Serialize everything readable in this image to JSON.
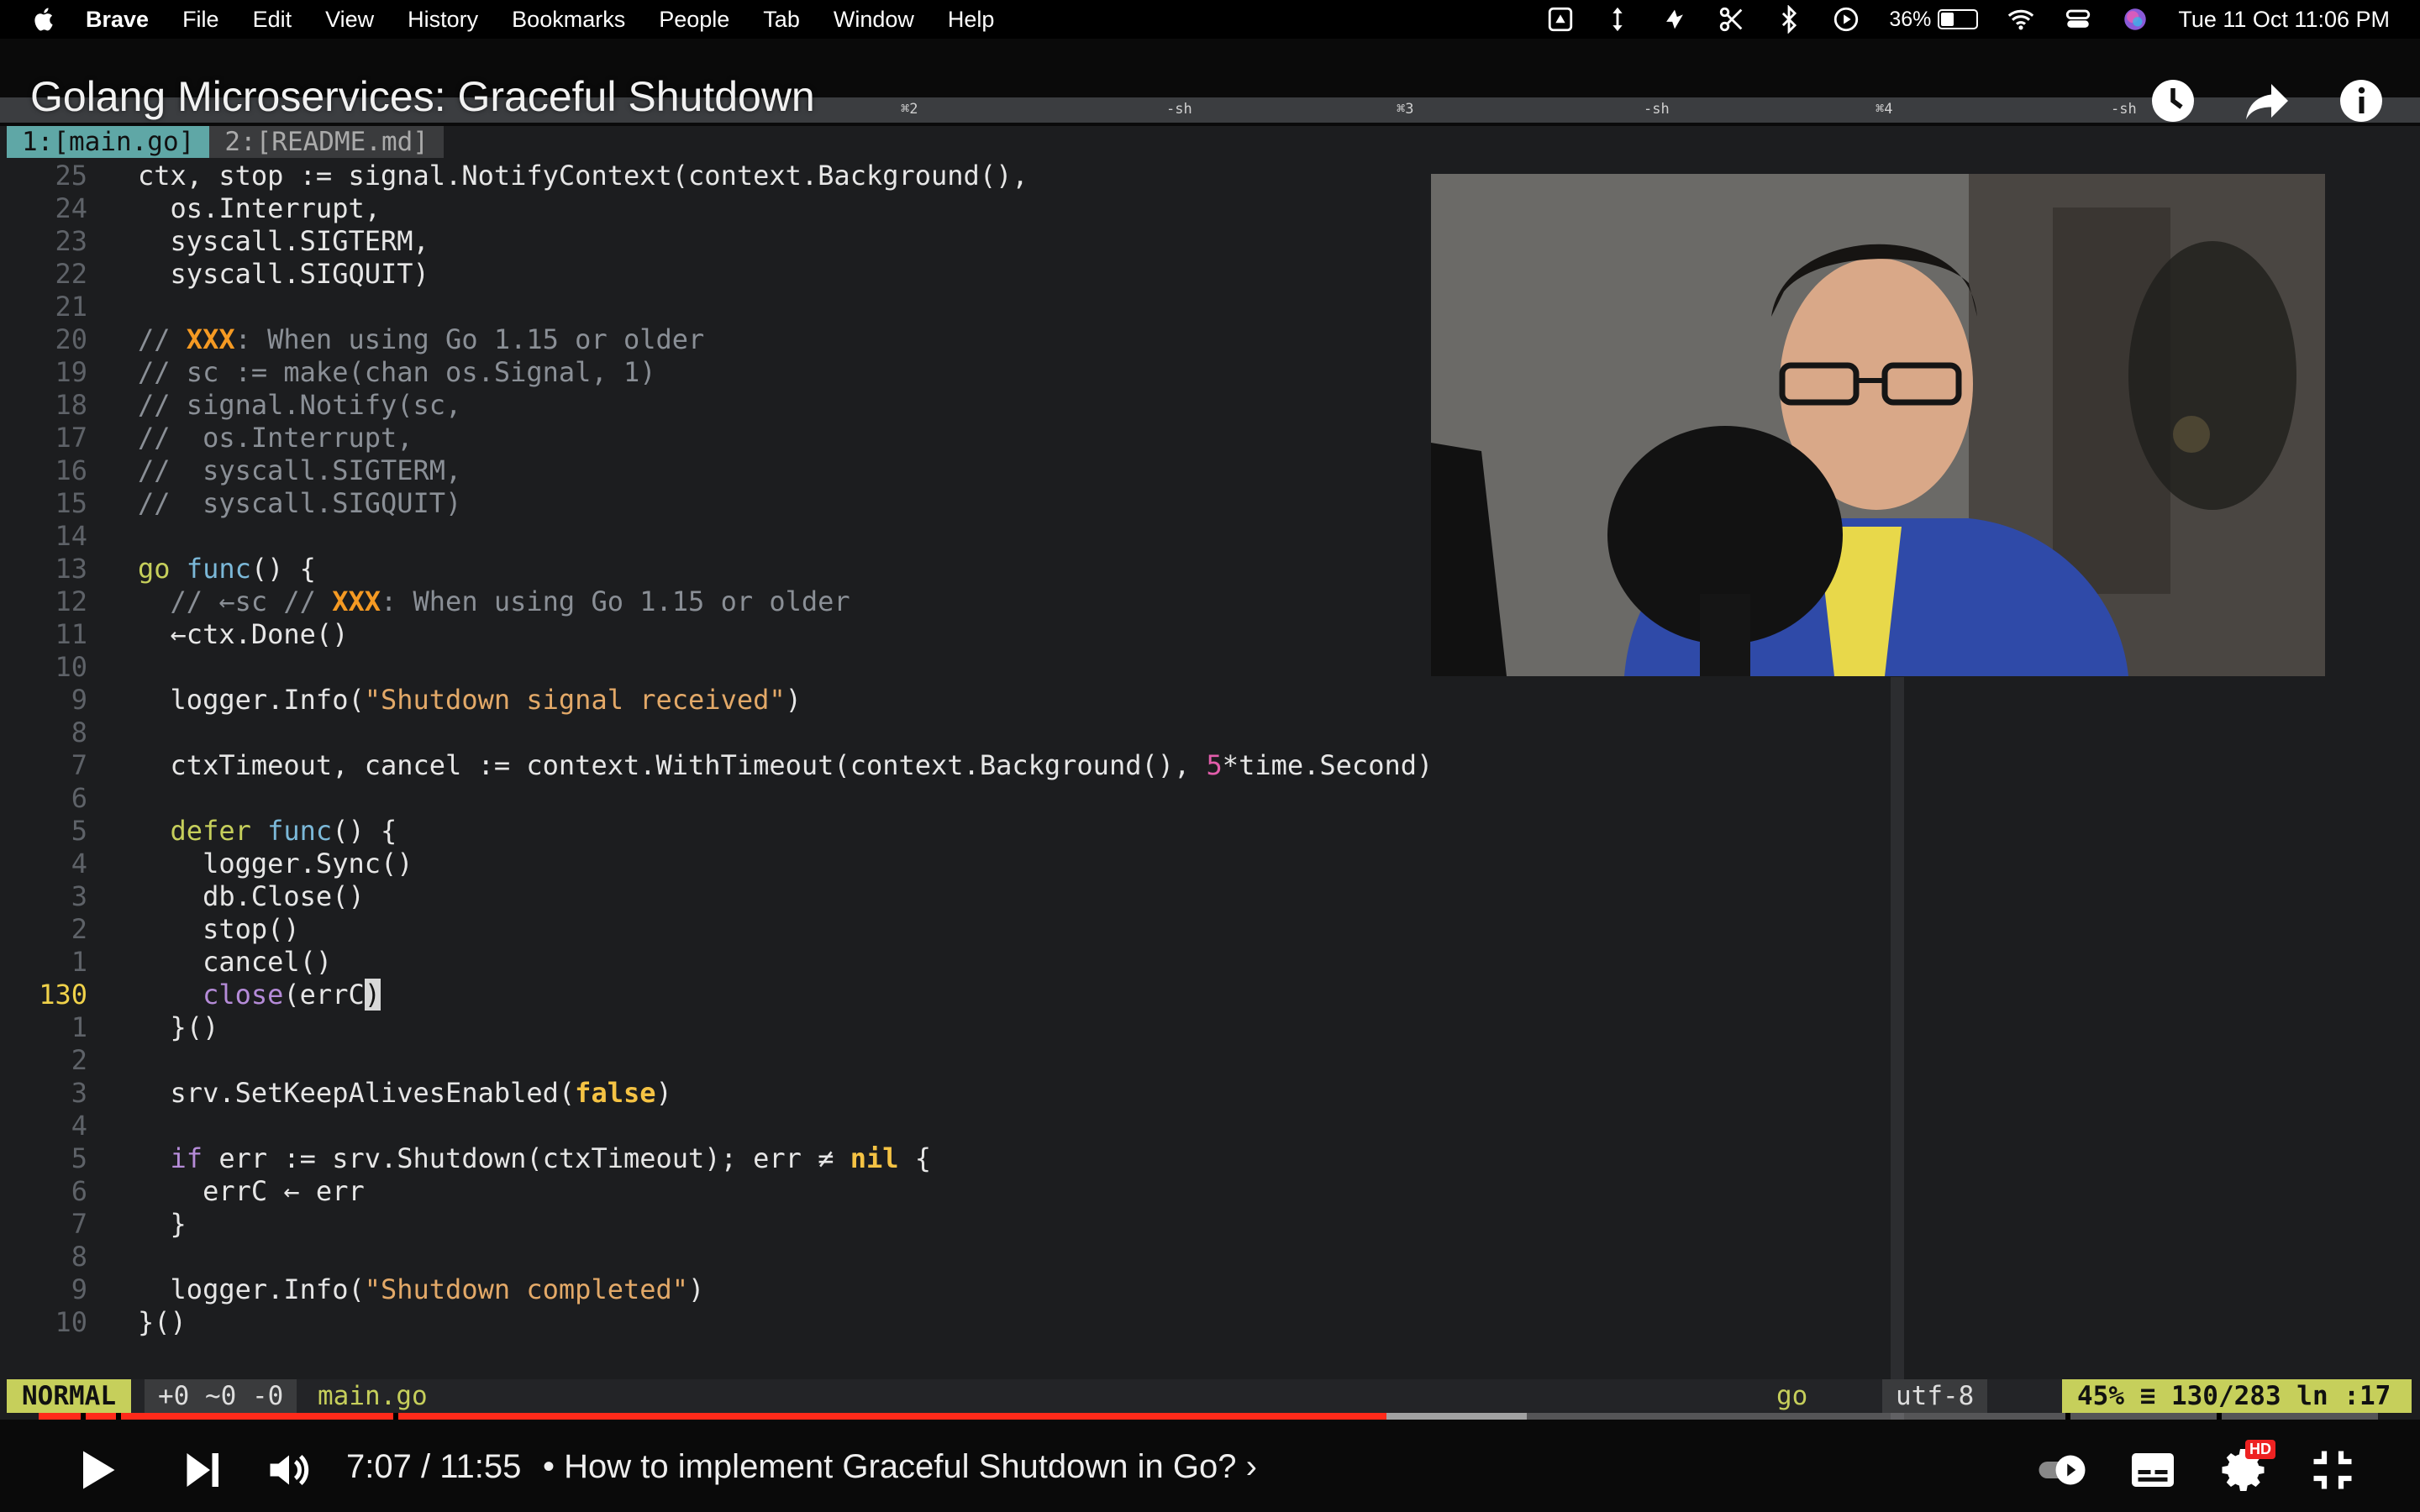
{
  "menubar": {
    "app": "Brave",
    "items": [
      "File",
      "Edit",
      "View",
      "History",
      "Bookmarks",
      "People",
      "Tab",
      "Window",
      "Help"
    ],
    "battery_percent": "36%",
    "battery_level": 0.36,
    "clock": "Tue 11 Oct  11:06 PM"
  },
  "video": {
    "title": "Golang Microservices: Graceful Shutdown",
    "top_icons": [
      "clock-icon",
      "share-icon",
      "info-icon"
    ]
  },
  "tmux": {
    "labels": [
      "⌘2",
      "-sh",
      "⌘3",
      "-sh",
      "⌘4",
      "-sh"
    ]
  },
  "editor": {
    "tabs": [
      "1:[main.go]",
      "2:[README.md]"
    ],
    "line_numbers": [
      "25",
      "24",
      "23",
      "22",
      "21",
      "20",
      "19",
      "18",
      "17",
      "16",
      "15",
      "14",
      "13",
      "12",
      "11",
      "10",
      "9",
      "8",
      "7",
      "6",
      "5",
      "4",
      "3",
      "2",
      "1",
      "130",
      "1",
      "2",
      "3",
      "4",
      "5",
      "6",
      "7",
      "8",
      "9",
      "10"
    ],
    "lines": [
      {
        "a": "ctx, stop := signal.NotifyContext(context.Background(),"
      },
      {
        "a": "  os.Interrupt,"
      },
      {
        "a": "  syscall.SIGTERM,"
      },
      {
        "a": "  syscall.SIGQUIT)"
      },
      {
        "a": ""
      },
      {
        "a": "// ",
        "b": "XXX",
        "c": ": When using Go 1.15 or older"
      },
      {
        "a": "// sc := make(chan os.Signal, 1)"
      },
      {
        "a": "// signal.Notify(sc,"
      },
      {
        "a": "//  os.Interrupt,"
      },
      {
        "a": "//  syscall.SIGTERM,"
      },
      {
        "a": "//  syscall.SIGQUIT)"
      },
      {
        "a": ""
      },
      {
        "a": "go",
        "b": " func",
        "c": "() {"
      },
      {
        "a": "  // ←sc // ",
        "b": "XXX",
        "c": ": When using Go 1.15 or older"
      },
      {
        "a": "  ←ctx.Done()"
      },
      {
        "a": ""
      },
      {
        "a": "  logger.Info(",
        "b": "\"Shutdown signal received\"",
        "c": ")"
      },
      {
        "a": ""
      },
      {
        "a": "  ctxTimeout, cancel := context.WithTimeout(context.Background(), ",
        "b": "5",
        "c": "*time.Second)"
      },
      {
        "a": ""
      },
      {
        "a": "  defer",
        "b": " func",
        "c": "() {"
      },
      {
        "a": "    logger.Sync()"
      },
      {
        "a": "    db.Close()"
      },
      {
        "a": "    stop()"
      },
      {
        "a": "    cancel()"
      },
      {
        "a": "    close",
        "b": "(errC",
        "c": ")"
      },
      {
        "a": "  }()"
      },
      {
        "a": ""
      },
      {
        "a": "  srv.SetKeepAlivesEnabled(",
        "b": "false",
        "c": ")"
      },
      {
        "a": ""
      },
      {
        "a": "  if",
        "b": " err := srv.Shutdown(ctxTimeout); err ≠ ",
        "c": "nil",
        "d": " {"
      },
      {
        "a": "    errC ← err"
      },
      {
        "a": "  }"
      },
      {
        "a": ""
      },
      {
        "a": "  logger.Info(",
        "b": "\"Shutdown completed\"",
        "c": ")"
      },
      {
        "a": "}()"
      }
    ]
  },
  "statusline": {
    "mode": "NORMAL",
    "diff": "+0 ~0 -0",
    "filename": "main.go",
    "filetype": "go",
    "encoding": "utf-8",
    "position": "45% ≡ 130/283  ln :17"
  },
  "player": {
    "time": "7:07 / 11:55",
    "chapter": "• How to implement Graceful Shutdown in Go? ›",
    "played_fraction": 0.576,
    "buffered_fraction": 0.636,
    "hd_badge": "HD",
    "accent_color": "#ff2a1a"
  }
}
